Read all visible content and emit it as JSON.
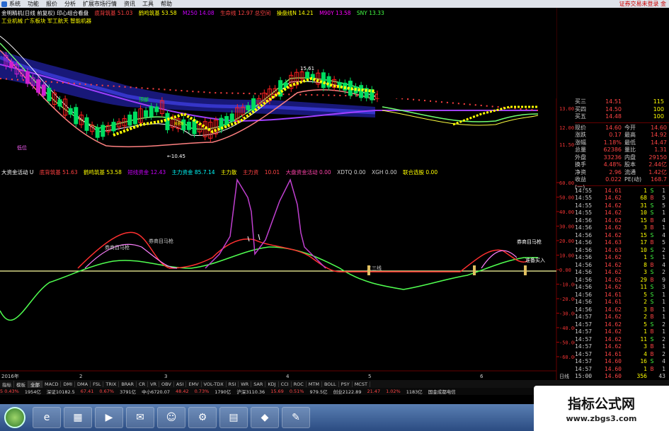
{
  "menubar": {
    "items": [
      "系统",
      "功能",
      "报价",
      "分析",
      "扩展市场行情",
      "资讯",
      "工具",
      "帮助"
    ],
    "right_text": "证券交易未登录 金"
  },
  "upper_chart": {
    "info_line1": [
      "金明精机(日线 前复权) 印心组合看盘",
      "底背筑基 51.03",
      "鹤鸣筑基 53.58",
      "M250 14.08",
      "生命线 12.97 总空间",
      "操盘线N 14.21",
      "M90Y 13.58",
      "SNY 13.33"
    ],
    "info_line2": "工业机械 广东板块 军工航天 智能机器",
    "price_labels": [
      "13.00",
      "12.00",
      "11.50"
    ],
    "annotations": [
      "10.45",
      "15.61",
      "低位",
      "顶部",
      "888"
    ]
  },
  "lower_chart": {
    "info_line": [
      "大资金活动 U",
      "底背筑基 51.63",
      "鹤鸣筑基 53.58",
      "短线资金 12.43",
      "主力资金 85.7.14",
      "主力散",
      "主力资",
      "10.01",
      "大盘资金活动 0.00",
      "XDTQ 0.00",
      "XGH 0.00",
      "联合选股 0.00"
    ],
    "y_labels": [
      "60.00",
      "50.00",
      "40.00",
      "30.00",
      "20.00",
      "10.00",
      "0.00",
      "-10.00",
      "-20.00",
      "-30.00",
      "-40.00",
      "-50.00",
      "-60.00"
    ],
    "annotations": [
      "券商目马枪",
      "券商目马枪",
      "三三线",
      "准备买入",
      "券商目马枪"
    ],
    "date_labels": [
      "2016年",
      "2",
      "3",
      "4",
      "5",
      "6"
    ],
    "bottom_note": "日线"
  },
  "quote_panel": {
    "asks": [
      {
        "label": "买三",
        "price": "14.51",
        "vol": "115"
      },
      {
        "label": "买四",
        "price": "14.50",
        "vol": "100"
      },
      {
        "label": "买五",
        "price": "14.48",
        "vol": "100"
      }
    ],
    "stats": [
      {
        "a": "现价",
        "b": "14.60",
        "c": "今开",
        "d": "14.60"
      },
      {
        "a": "涨跌",
        "b": "0.17",
        "c": "最高",
        "d": "14.92"
      },
      {
        "a": "涨幅",
        "b": "1.18%",
        "c": "最低",
        "d": "14.47"
      },
      {
        "a": "总量",
        "b": "62386",
        "c": "量比",
        "d": "1.31"
      },
      {
        "a": "外盘",
        "b": "33236",
        "c": "内盘",
        "d": "29150"
      },
      {
        "a": "换手",
        "b": "4.48%",
        "c": "股本",
        "d": "2.44亿"
      },
      {
        "a": "净资",
        "b": "2.96",
        "c": "流通",
        "d": "1.42亿"
      },
      {
        "a": "收益(一)",
        "b": "0.022",
        "c": "PE(动)",
        "d": "168.7"
      }
    ],
    "ticks": [
      {
        "t": "14:55",
        "p": "14.61",
        "v": "1",
        "s": "S",
        "n": "1"
      },
      {
        "t": "14:55",
        "p": "14.62",
        "v": "68",
        "s": "B",
        "n": "5"
      },
      {
        "t": "14:55",
        "p": "14.62",
        "v": "31",
        "s": "S",
        "n": "5"
      },
      {
        "t": "14:55",
        "p": "14.62",
        "v": "10",
        "s": "S",
        "n": "1"
      },
      {
        "t": "14:56",
        "p": "14.62",
        "v": "15",
        "s": "B",
        "n": "4"
      },
      {
        "t": "14:56",
        "p": "14.62",
        "v": "3",
        "s": "B",
        "n": "1"
      },
      {
        "t": "14:56",
        "p": "14.62",
        "v": "15",
        "s": "S",
        "n": "4"
      },
      {
        "t": "14:56",
        "p": "14.63",
        "v": "17",
        "s": "B",
        "n": "5"
      },
      {
        "t": "14:56",
        "p": "14.63",
        "v": "10",
        "s": "S",
        "n": "2"
      },
      {
        "t": "14:56",
        "p": "14.62",
        "v": "1",
        "s": "S",
        "n": "1"
      },
      {
        "t": "14:56",
        "p": "14.62",
        "v": "8",
        "s": "B",
        "n": "4"
      },
      {
        "t": "14:56",
        "p": "14.62",
        "v": "3",
        "s": "S",
        "n": "2"
      },
      {
        "t": "14:56",
        "p": "14.62",
        "v": "29",
        "s": "B",
        "n": "9"
      },
      {
        "t": "14:56",
        "p": "14.62",
        "v": "11",
        "s": "S",
        "n": "3"
      },
      {
        "t": "14:56",
        "p": "14.61",
        "v": "5",
        "s": "S",
        "n": "1"
      },
      {
        "t": "14:56",
        "p": "14.61",
        "v": "2",
        "s": "S",
        "n": "1"
      },
      {
        "t": "14:56",
        "p": "14.62",
        "v": "3",
        "s": "B",
        "n": "1"
      },
      {
        "t": "14:57",
        "p": "14.62",
        "v": "2",
        "s": "B",
        "n": "1"
      },
      {
        "t": "14:57",
        "p": "14.62",
        "v": "5",
        "s": "S",
        "n": "2"
      },
      {
        "t": "14:57",
        "p": "14.62",
        "v": "1",
        "s": "B",
        "n": "1"
      },
      {
        "t": "14:57",
        "p": "14.62",
        "v": "11",
        "s": "S",
        "n": "2"
      },
      {
        "t": "14:57",
        "p": "14.62",
        "v": "3",
        "s": "B",
        "n": "1"
      },
      {
        "t": "14:57",
        "p": "14.61",
        "v": "4",
        "s": "B",
        "n": "2"
      },
      {
        "t": "14:57",
        "p": "14.60",
        "v": "16",
        "s": "S",
        "n": "4"
      },
      {
        "t": "14:57",
        "p": "14.60",
        "v": "1",
        "s": "B",
        "n": "1"
      },
      {
        "t": "15:00",
        "p": "14.60",
        "v": "356",
        "s": "",
        "n": "43"
      }
    ]
  },
  "tabbar": {
    "items": [
      "指标",
      "模板",
      "全部",
      "MACD",
      "DMI",
      "DMA",
      "FSL",
      "TRIX",
      "BRAR",
      "CR",
      "VR",
      "OBV",
      "ASI",
      "EMV",
      "VOL-TDX",
      "RSI",
      "WR",
      "SAR",
      "KDJ",
      "CCI",
      "ROC",
      "MTM",
      "BOLL",
      "PSY",
      "MCST"
    ],
    "active_index": 2
  },
  "statusbar": {
    "items": [
      "5 0.43%",
      "1954亿",
      "深证10182.5",
      "67.41",
      "0.67%",
      "3791亿",
      "中小6720.07",
      "48.42",
      "0.73%",
      "1790亿",
      "沪深3110.36",
      "15.69",
      "0.51%",
      "979.5亿",
      "创业2122.89",
      "21.47",
      "1.02%",
      "1183亿",
      "国金成都电信"
    ]
  },
  "taskbar": {
    "buttons": [
      "e",
      "▦",
      "▶",
      "✉",
      "☺",
      "⚙",
      "▤",
      "◆",
      "✎"
    ]
  },
  "watermark": {
    "title": "指标公式网",
    "url": "www.zbgs3.com"
  },
  "colors": {
    "bg": "#000000",
    "up": "#ff3030",
    "down": "#00ff00",
    "purple": "#a040ff",
    "yellow": "#ffff00",
    "cyan": "#00ffff",
    "pink": "#ff60d0",
    "green_line": "#50ff50"
  }
}
